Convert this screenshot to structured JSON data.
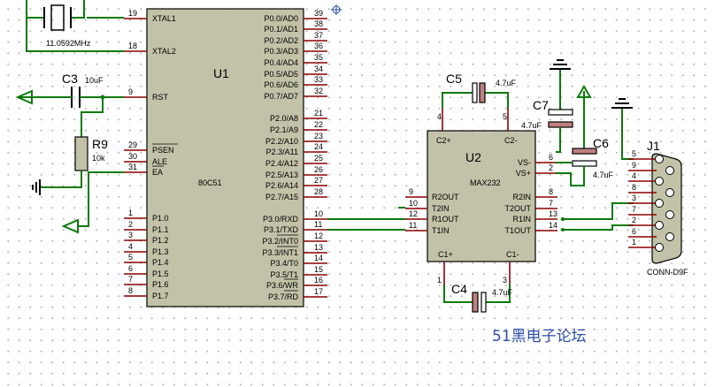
{
  "u1": {
    "ref": "U1",
    "part": "80C51",
    "left_pins": [
      {
        "num": "19",
        "name": "XTAL1"
      },
      {
        "num": "18",
        "name": "XTAL2"
      },
      {
        "num": "9",
        "name": "RST"
      },
      {
        "num": "29",
        "name": "PSEN"
      },
      {
        "num": "30",
        "name": "ALE"
      },
      {
        "num": "31",
        "name": "EA"
      },
      {
        "num": "1",
        "name": "P1.0"
      },
      {
        "num": "2",
        "name": "P1.1"
      },
      {
        "num": "3",
        "name": "P1.2"
      },
      {
        "num": "4",
        "name": "P1.3"
      },
      {
        "num": "5",
        "name": "P1.4"
      },
      {
        "num": "6",
        "name": "P1.5"
      },
      {
        "num": "7",
        "name": "P1.6"
      },
      {
        "num": "8",
        "name": "P1.7"
      }
    ],
    "right_pins": [
      {
        "num": "39",
        "name": "P0.0/AD0"
      },
      {
        "num": "38",
        "name": "P0.1/AD1"
      },
      {
        "num": "37",
        "name": "P0.2/AD2"
      },
      {
        "num": "36",
        "name": "P0.3/AD3"
      },
      {
        "num": "35",
        "name": "P0.4/AD4"
      },
      {
        "num": "34",
        "name": "P0.5/AD5"
      },
      {
        "num": "33",
        "name": "P0.6/AD6"
      },
      {
        "num": "32",
        "name": "P0.7/AD7"
      },
      {
        "num": "21",
        "name": "P2.0/A8"
      },
      {
        "num": "22",
        "name": "P2.1/A9"
      },
      {
        "num": "23",
        "name": "P2.2/A10"
      },
      {
        "num": "24",
        "name": "P2.3/A11"
      },
      {
        "num": "25",
        "name": "P2.4/A12"
      },
      {
        "num": "26",
        "name": "P2.5/A13"
      },
      {
        "num": "27",
        "name": "P2.6/A14"
      },
      {
        "num": "28",
        "name": "P2.7/A15"
      },
      {
        "num": "10",
        "name": "P3.0/RXD"
      },
      {
        "num": "11",
        "name": "P3.1/TXD"
      },
      {
        "num": "12",
        "name": "P3.2/INT0"
      },
      {
        "num": "13",
        "name": "P3.3/INT1"
      },
      {
        "num": "14",
        "name": "P3.4/T0"
      },
      {
        "num": "15",
        "name": "P3.5/T1"
      },
      {
        "num": "16",
        "name": "P3.6/WR"
      },
      {
        "num": "17",
        "name": "P3.7/RD"
      }
    ]
  },
  "u2": {
    "ref": "U2",
    "part": "MAX232",
    "top_pins": [
      {
        "num": "4",
        "name": "C2+"
      },
      {
        "num": "5",
        "name": "C2-"
      }
    ],
    "bottom_pins": [
      {
        "num": "1",
        "name": "C1+"
      },
      {
        "num": "3",
        "name": "C1-"
      }
    ],
    "left_pins": [
      {
        "num": "9",
        "name": "R2OUT"
      },
      {
        "num": "10",
        "name": "T2IN"
      },
      {
        "num": "12",
        "name": "R1OUT"
      },
      {
        "num": "11",
        "name": "T1IN"
      }
    ],
    "right_pins": [
      {
        "num": "6",
        "name": "VS-"
      },
      {
        "num": "2",
        "name": "VS+"
      },
      {
        "num": "8",
        "name": "R2IN"
      },
      {
        "num": "7",
        "name": "T2OUT"
      },
      {
        "num": "13",
        "name": "R1IN"
      },
      {
        "num": "14",
        "name": "T1OUT"
      }
    ]
  },
  "crystal": {
    "value": "11.0592MHz"
  },
  "c3": {
    "ref": "C3",
    "value": "10uF"
  },
  "r9": {
    "ref": "R9",
    "value": "10k"
  },
  "c4": {
    "ref": "C4",
    "value": "4.7uF"
  },
  "c5": {
    "ref": "C5",
    "value": "4.7uF"
  },
  "c6": {
    "ref": "C6",
    "value": "4.7uF"
  },
  "c7": {
    "ref": "C7",
    "value": "4.7uF"
  },
  "j1": {
    "ref": "J1",
    "part": "CONN-D9F",
    "pins": [
      "5",
      "9",
      "4",
      "8",
      "3",
      "7",
      "2",
      "6",
      "1"
    ]
  },
  "watermark": "51黑电子论坛",
  "colors": {
    "wire": "#0a7a0a",
    "pin": "#8b0000",
    "chip_body": "#c2c2a8",
    "watermark": "#2b4ea8"
  }
}
